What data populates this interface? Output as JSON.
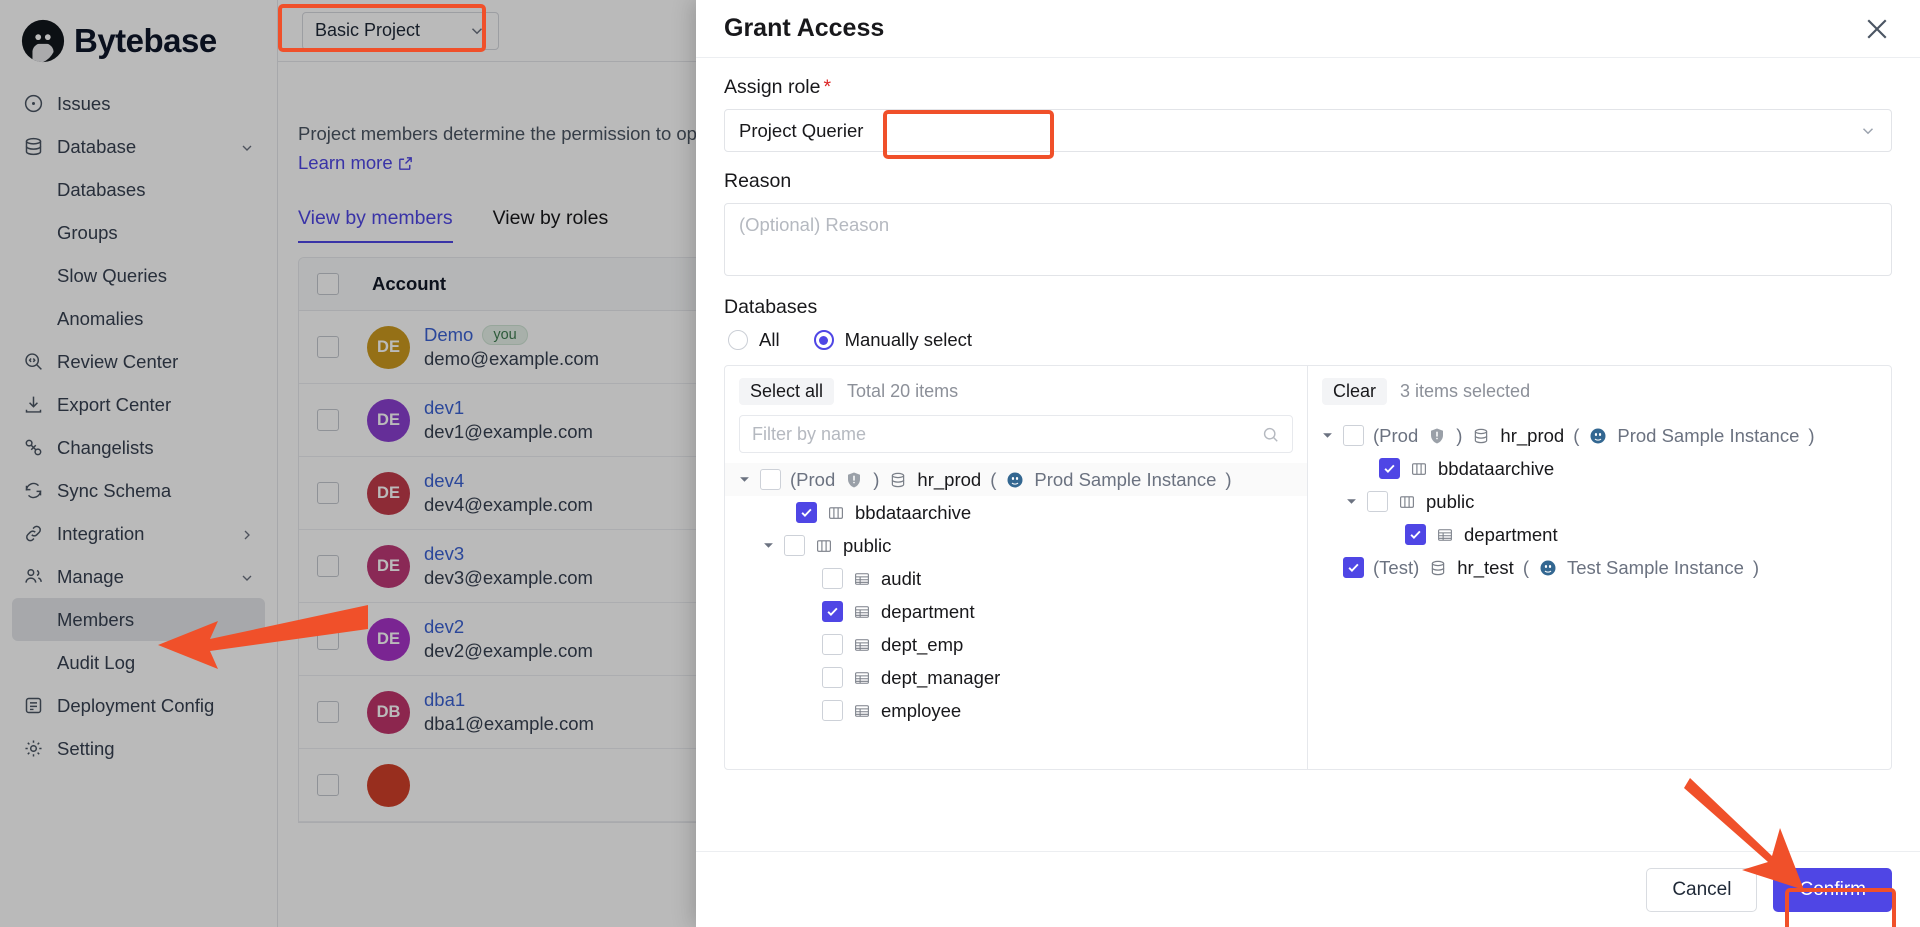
{
  "app": {
    "brand": "Bytebase"
  },
  "sidebar": {
    "items": [
      {
        "label": "Issues",
        "icon": "issues-icon",
        "type": "top"
      },
      {
        "label": "Database",
        "icon": "database-icon",
        "type": "top",
        "chevron": "chevron-down-icon"
      },
      {
        "label": "Databases",
        "type": "sub"
      },
      {
        "label": "Groups",
        "type": "sub"
      },
      {
        "label": "Slow Queries",
        "type": "sub"
      },
      {
        "label": "Anomalies",
        "type": "sub"
      },
      {
        "label": "Review Center",
        "icon": "review-center-icon",
        "type": "top"
      },
      {
        "label": "Export Center",
        "icon": "export-center-icon",
        "type": "top"
      },
      {
        "label": "Changelists",
        "icon": "changelists-icon",
        "type": "top"
      },
      {
        "label": "Sync Schema",
        "icon": "sync-schema-icon",
        "type": "top"
      },
      {
        "label": "Integration",
        "icon": "integration-icon",
        "type": "top",
        "chevron": "chevron-right-icon"
      },
      {
        "label": "Manage",
        "icon": "manage-icon",
        "type": "top",
        "chevron": "chevron-down-icon"
      },
      {
        "label": "Members",
        "type": "sub",
        "active": true
      },
      {
        "label": "Audit Log",
        "type": "sub"
      },
      {
        "label": "Deployment Config",
        "icon": "deployment-config-icon",
        "type": "top"
      },
      {
        "label": "Setting",
        "icon": "setting-icon",
        "type": "top"
      }
    ]
  },
  "topbar": {
    "project": "Basic Project",
    "chevron": "chevron-down-icon"
  },
  "page": {
    "description": "Project members determine the permission to operate database",
    "learn_more": "Learn more",
    "tabs": [
      {
        "label": "View by members",
        "active": true
      },
      {
        "label": "View by roles",
        "active": false
      }
    ],
    "table": {
      "columns": [
        "Account"
      ],
      "rows": [
        {
          "name": "Demo",
          "email": "demo@example.com",
          "initials": "DE",
          "color": "#cc9a1f",
          "badge": "you"
        },
        {
          "name": "dev1",
          "email": "dev1@example.com",
          "initials": "DE",
          "color": "#8b3fd1",
          "badge": ""
        },
        {
          "name": "dev4",
          "email": "dev4@example.com",
          "initials": "DE",
          "color": "#c23b4b",
          "badge": ""
        },
        {
          "name": "dev3",
          "email": "dev3@example.com",
          "initials": "DE",
          "color": "#bd3977",
          "badge": ""
        },
        {
          "name": "dev2",
          "email": "dev2@example.com",
          "initials": "DE",
          "color": "#a834c9",
          "badge": ""
        },
        {
          "name": "dba1",
          "email": "dba1@example.com",
          "initials": "DB",
          "color": "#c0356b",
          "badge": ""
        }
      ]
    }
  },
  "drawer": {
    "title": "Grant Access",
    "close_icon": "close-icon",
    "assign_role_label": "Assign role",
    "assign_role_required": "*",
    "assign_role_value": "Project Querier",
    "reason_label": "Reason",
    "reason_placeholder": "(Optional) Reason",
    "reason_value": "",
    "databases_label": "Databases",
    "radio_all": "All",
    "radio_manual": "Manually select",
    "radio_selected": "Manually select",
    "left_pane": {
      "select_all": "Select all",
      "total": "Total 20 items",
      "filter_placeholder": "Filter by name",
      "search_icon": "search-icon",
      "tree": [
        {
          "indent": 0,
          "caret": "down",
          "checked": false,
          "env": "(Prod",
          "shield": true,
          "env_close": ")",
          "icon": "database-icon",
          "name": "hr_prod",
          "suffix": "(",
          "instance_icon": "postgres-icon",
          "instance": "Prod Sample Instance",
          "suffix_close": ")"
        },
        {
          "indent": 1,
          "caret": "none",
          "checked": true,
          "icon": "schema-icon",
          "name": "bbdataarchive"
        },
        {
          "indent": 1,
          "caret": "down",
          "checked": false,
          "icon": "schema-icon",
          "name": "public"
        },
        {
          "indent": 2,
          "caret": "none",
          "checked": false,
          "icon": "table-icon",
          "name": "audit"
        },
        {
          "indent": 2,
          "caret": "none",
          "checked": true,
          "icon": "table-icon",
          "name": "department"
        },
        {
          "indent": 2,
          "caret": "none",
          "checked": false,
          "icon": "table-icon",
          "name": "dept_emp"
        },
        {
          "indent": 2,
          "caret": "none",
          "checked": false,
          "icon": "table-icon",
          "name": "dept_manager"
        },
        {
          "indent": 2,
          "caret": "none",
          "checked": false,
          "icon": "table-icon",
          "name": "employee"
        }
      ]
    },
    "right_pane": {
      "clear": "Clear",
      "selected_count": "3 items selected",
      "tree": [
        {
          "indent": 0,
          "caret": "down",
          "checked": false,
          "env": "(Prod",
          "shield": true,
          "env_close": ")",
          "icon": "database-icon",
          "name": "hr_prod",
          "suffix": "(",
          "instance_icon": "postgres-icon",
          "instance": "Prod Sample Instance",
          "suffix_close": ")"
        },
        {
          "indent": 1,
          "caret": "none",
          "checked": true,
          "icon": "schema-icon",
          "name": "bbdataarchive"
        },
        {
          "indent": 1,
          "caret": "down",
          "checked": false,
          "icon": "schema-icon",
          "name": "public"
        },
        {
          "indent": 2,
          "caret": "none",
          "checked": true,
          "icon": "table-icon",
          "name": "department"
        },
        {
          "indent": 0,
          "caret": "none",
          "checked": true,
          "env": "(Test)",
          "shield": false,
          "env_close": "",
          "icon": "database-icon",
          "name": "hr_test",
          "suffix": "(",
          "instance_icon": "postgres-icon",
          "instance": "Test Sample Instance",
          "suffix_close": ")"
        }
      ]
    },
    "cancel": "Cancel",
    "confirm": "Confirm"
  },
  "colors": {
    "accent": "#4f46e5",
    "annotation": "#f0502a",
    "link": "#3b62d4"
  }
}
